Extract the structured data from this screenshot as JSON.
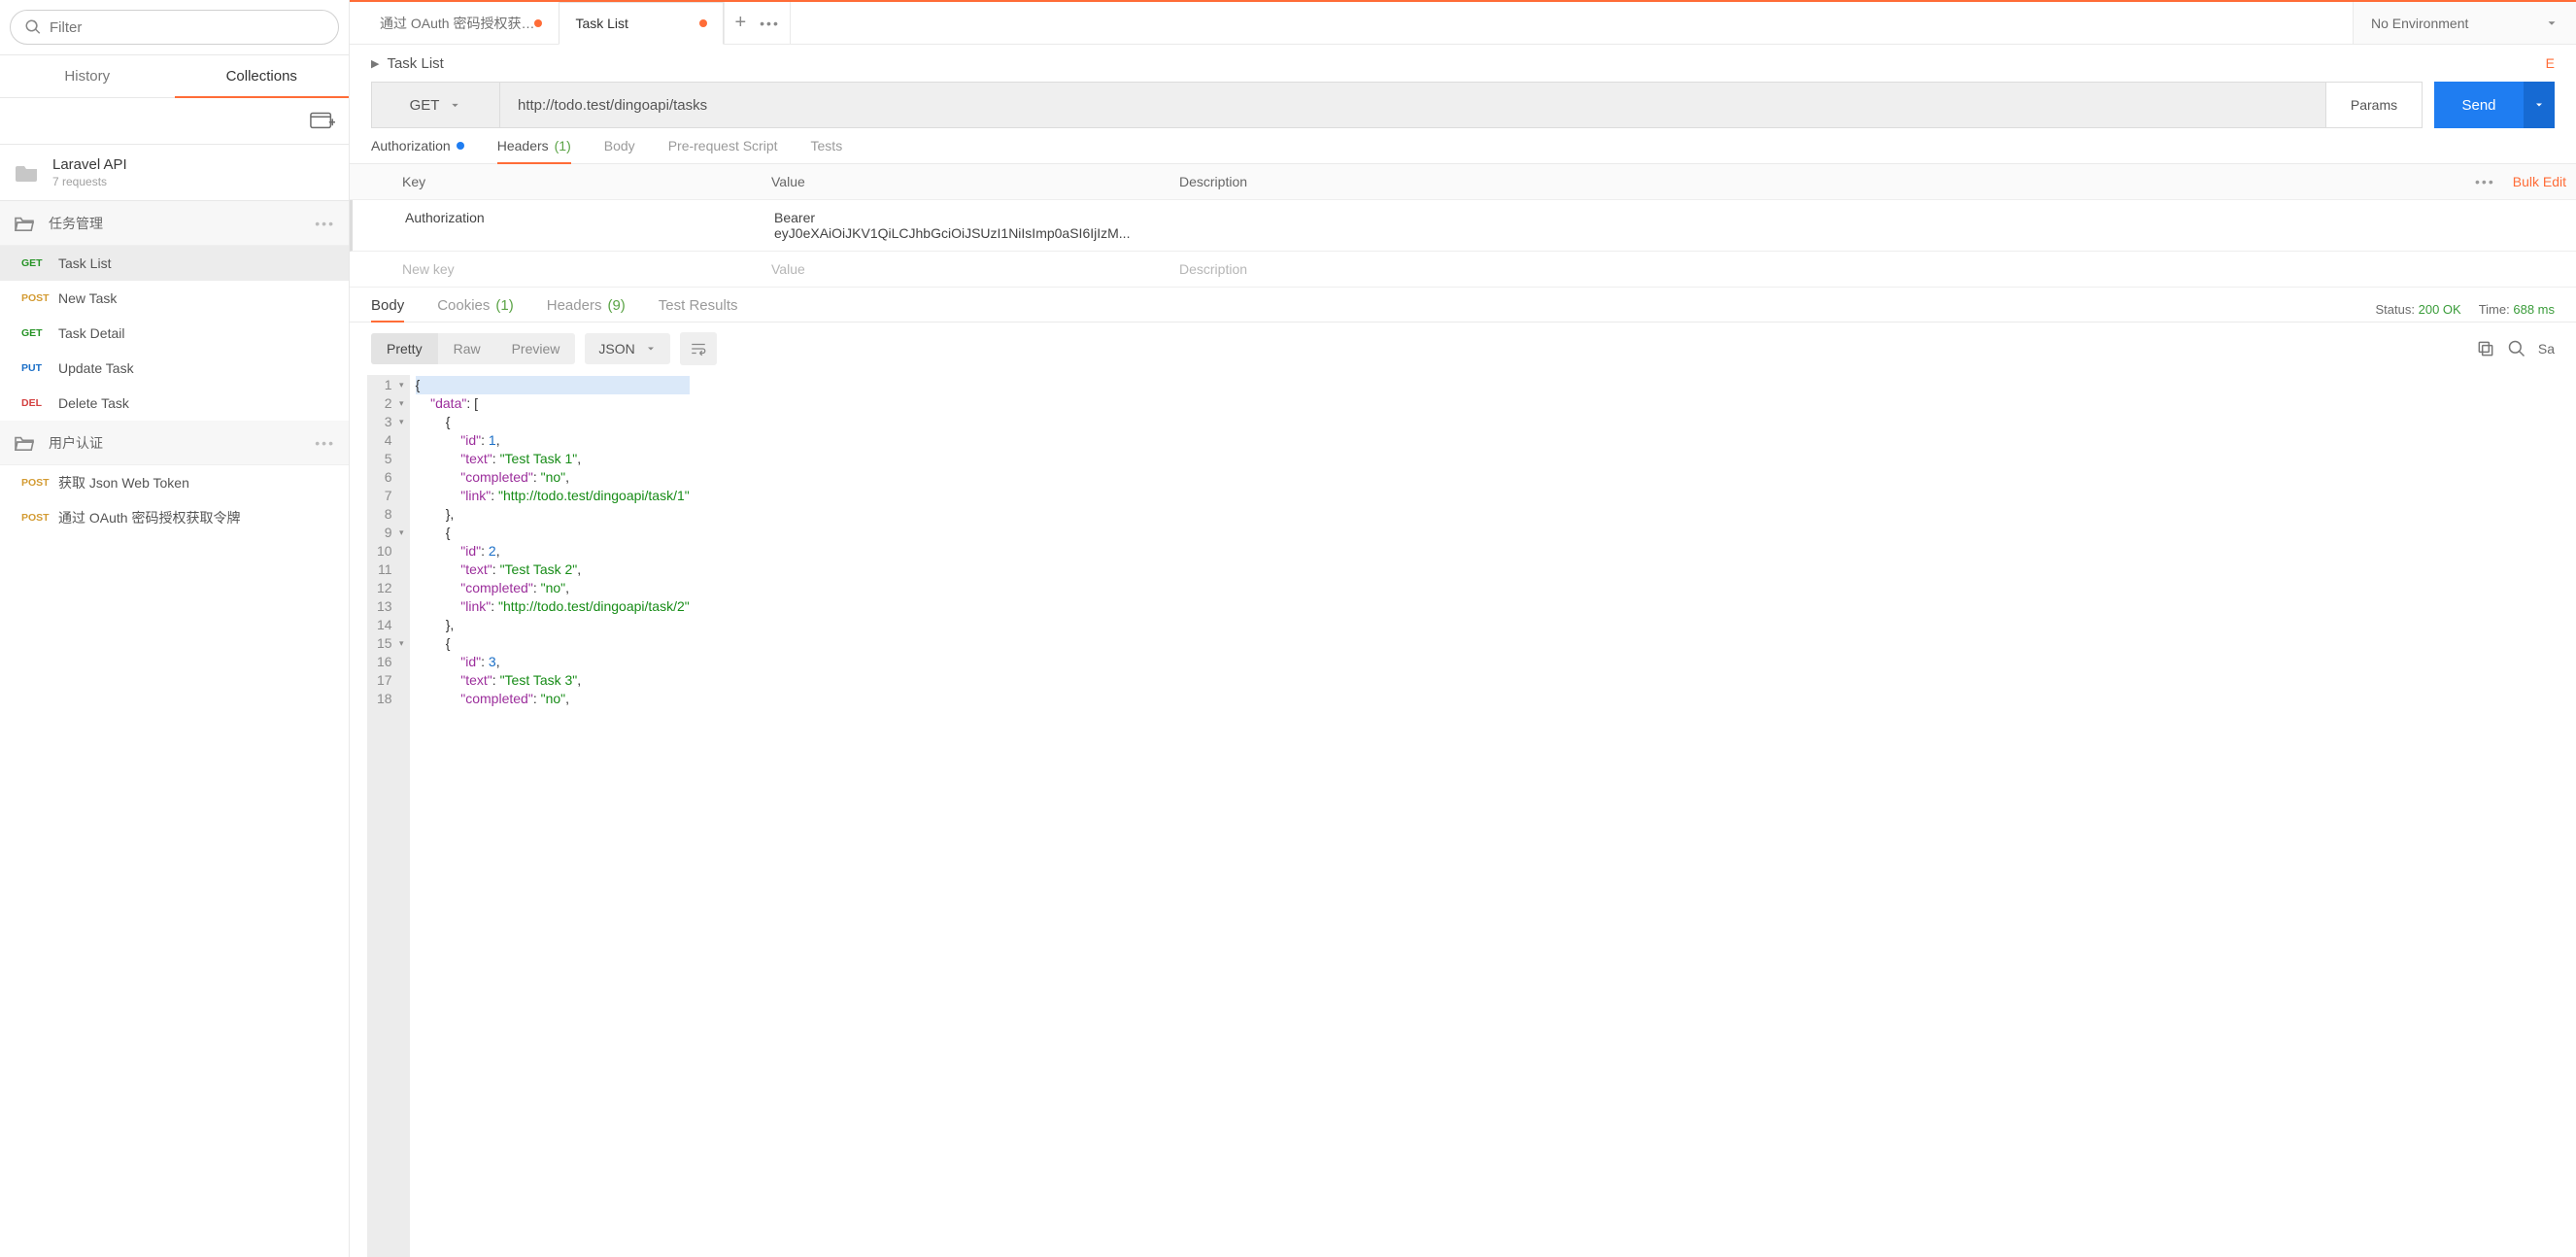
{
  "sidebar": {
    "filter_placeholder": "Filter",
    "tabs": {
      "history": "History",
      "collections": "Collections"
    },
    "collection": {
      "name": "Laravel API",
      "meta": "7 requests"
    },
    "folders": [
      {
        "name": "任务管理",
        "items": [
          {
            "verb": "GET",
            "label": "Task List",
            "active": true
          },
          {
            "verb": "POST",
            "label": "New Task"
          },
          {
            "verb": "GET",
            "label": "Task Detail"
          },
          {
            "verb": "PUT",
            "label": "Update Task"
          },
          {
            "verb": "DEL",
            "label": "Delete Task"
          }
        ]
      },
      {
        "name": "用户认证",
        "items": [
          {
            "verb": "POST",
            "label": "获取 Json Web Token"
          },
          {
            "verb": "POST",
            "label": "通过 OAuth 密码授权获取令牌"
          }
        ]
      }
    ]
  },
  "tabs": [
    {
      "label": "通过 OAuth 密码授权获…",
      "dirty": true
    },
    {
      "label": "Task List",
      "dirty": true,
      "active": true
    }
  ],
  "env": "No Environment",
  "breadcrumb": "Task List",
  "examples_link": "E",
  "request": {
    "method": "GET",
    "url": "http://todo.test/dingoapi/tasks",
    "params_btn": "Params",
    "send_btn": "Send",
    "tabs": {
      "auth": "Authorization",
      "headers": "Headers",
      "headers_count": "(1)",
      "body": "Body",
      "prereq": "Pre-request Script",
      "tests": "Tests"
    },
    "headers_table": {
      "cols": {
        "key": "Key",
        "value": "Value",
        "desc": "Description"
      },
      "rows": [
        {
          "key": "Authorization",
          "value": "Bearer eyJ0eXAiOiJKV1QiLCJhbGciOiJSUzI1NiIsImp0aSI6IjIzM..."
        }
      ],
      "new_row": {
        "key": "New key",
        "value": "Value",
        "desc": "Description"
      },
      "bulk": "Bulk Edit"
    }
  },
  "response": {
    "tabs": {
      "body": "Body",
      "cookies": "Cookies",
      "cookies_count": "(1)",
      "headers": "Headers",
      "headers_count": "(9)",
      "tests": "Test Results"
    },
    "status_label": "Status:",
    "status_value": "200 OK",
    "time_label": "Time:",
    "time_value": "688 ms",
    "save_partial": "Sa",
    "view": {
      "pretty": "Pretty",
      "raw": "Raw",
      "preview": "Preview",
      "format": "JSON"
    },
    "code_lines": [
      "{",
      "    \"data\": [",
      "        {",
      "            \"id\": 1,",
      "            \"text\": \"Test Task 1\",",
      "            \"completed\": \"no\",",
      "            \"link\": \"http://todo.test/dingoapi/task/1\"",
      "        },",
      "        {",
      "            \"id\": 2,",
      "            \"text\": \"Test Task 2\",",
      "            \"completed\": \"no\",",
      "            \"link\": \"http://todo.test/dingoapi/task/2\"",
      "        },",
      "        {",
      "            \"id\": 3,",
      "            \"text\": \"Test Task 3\",",
      "            \"completed\": \"no\","
    ],
    "fold_lines": [
      1,
      2,
      3,
      9,
      15
    ]
  }
}
